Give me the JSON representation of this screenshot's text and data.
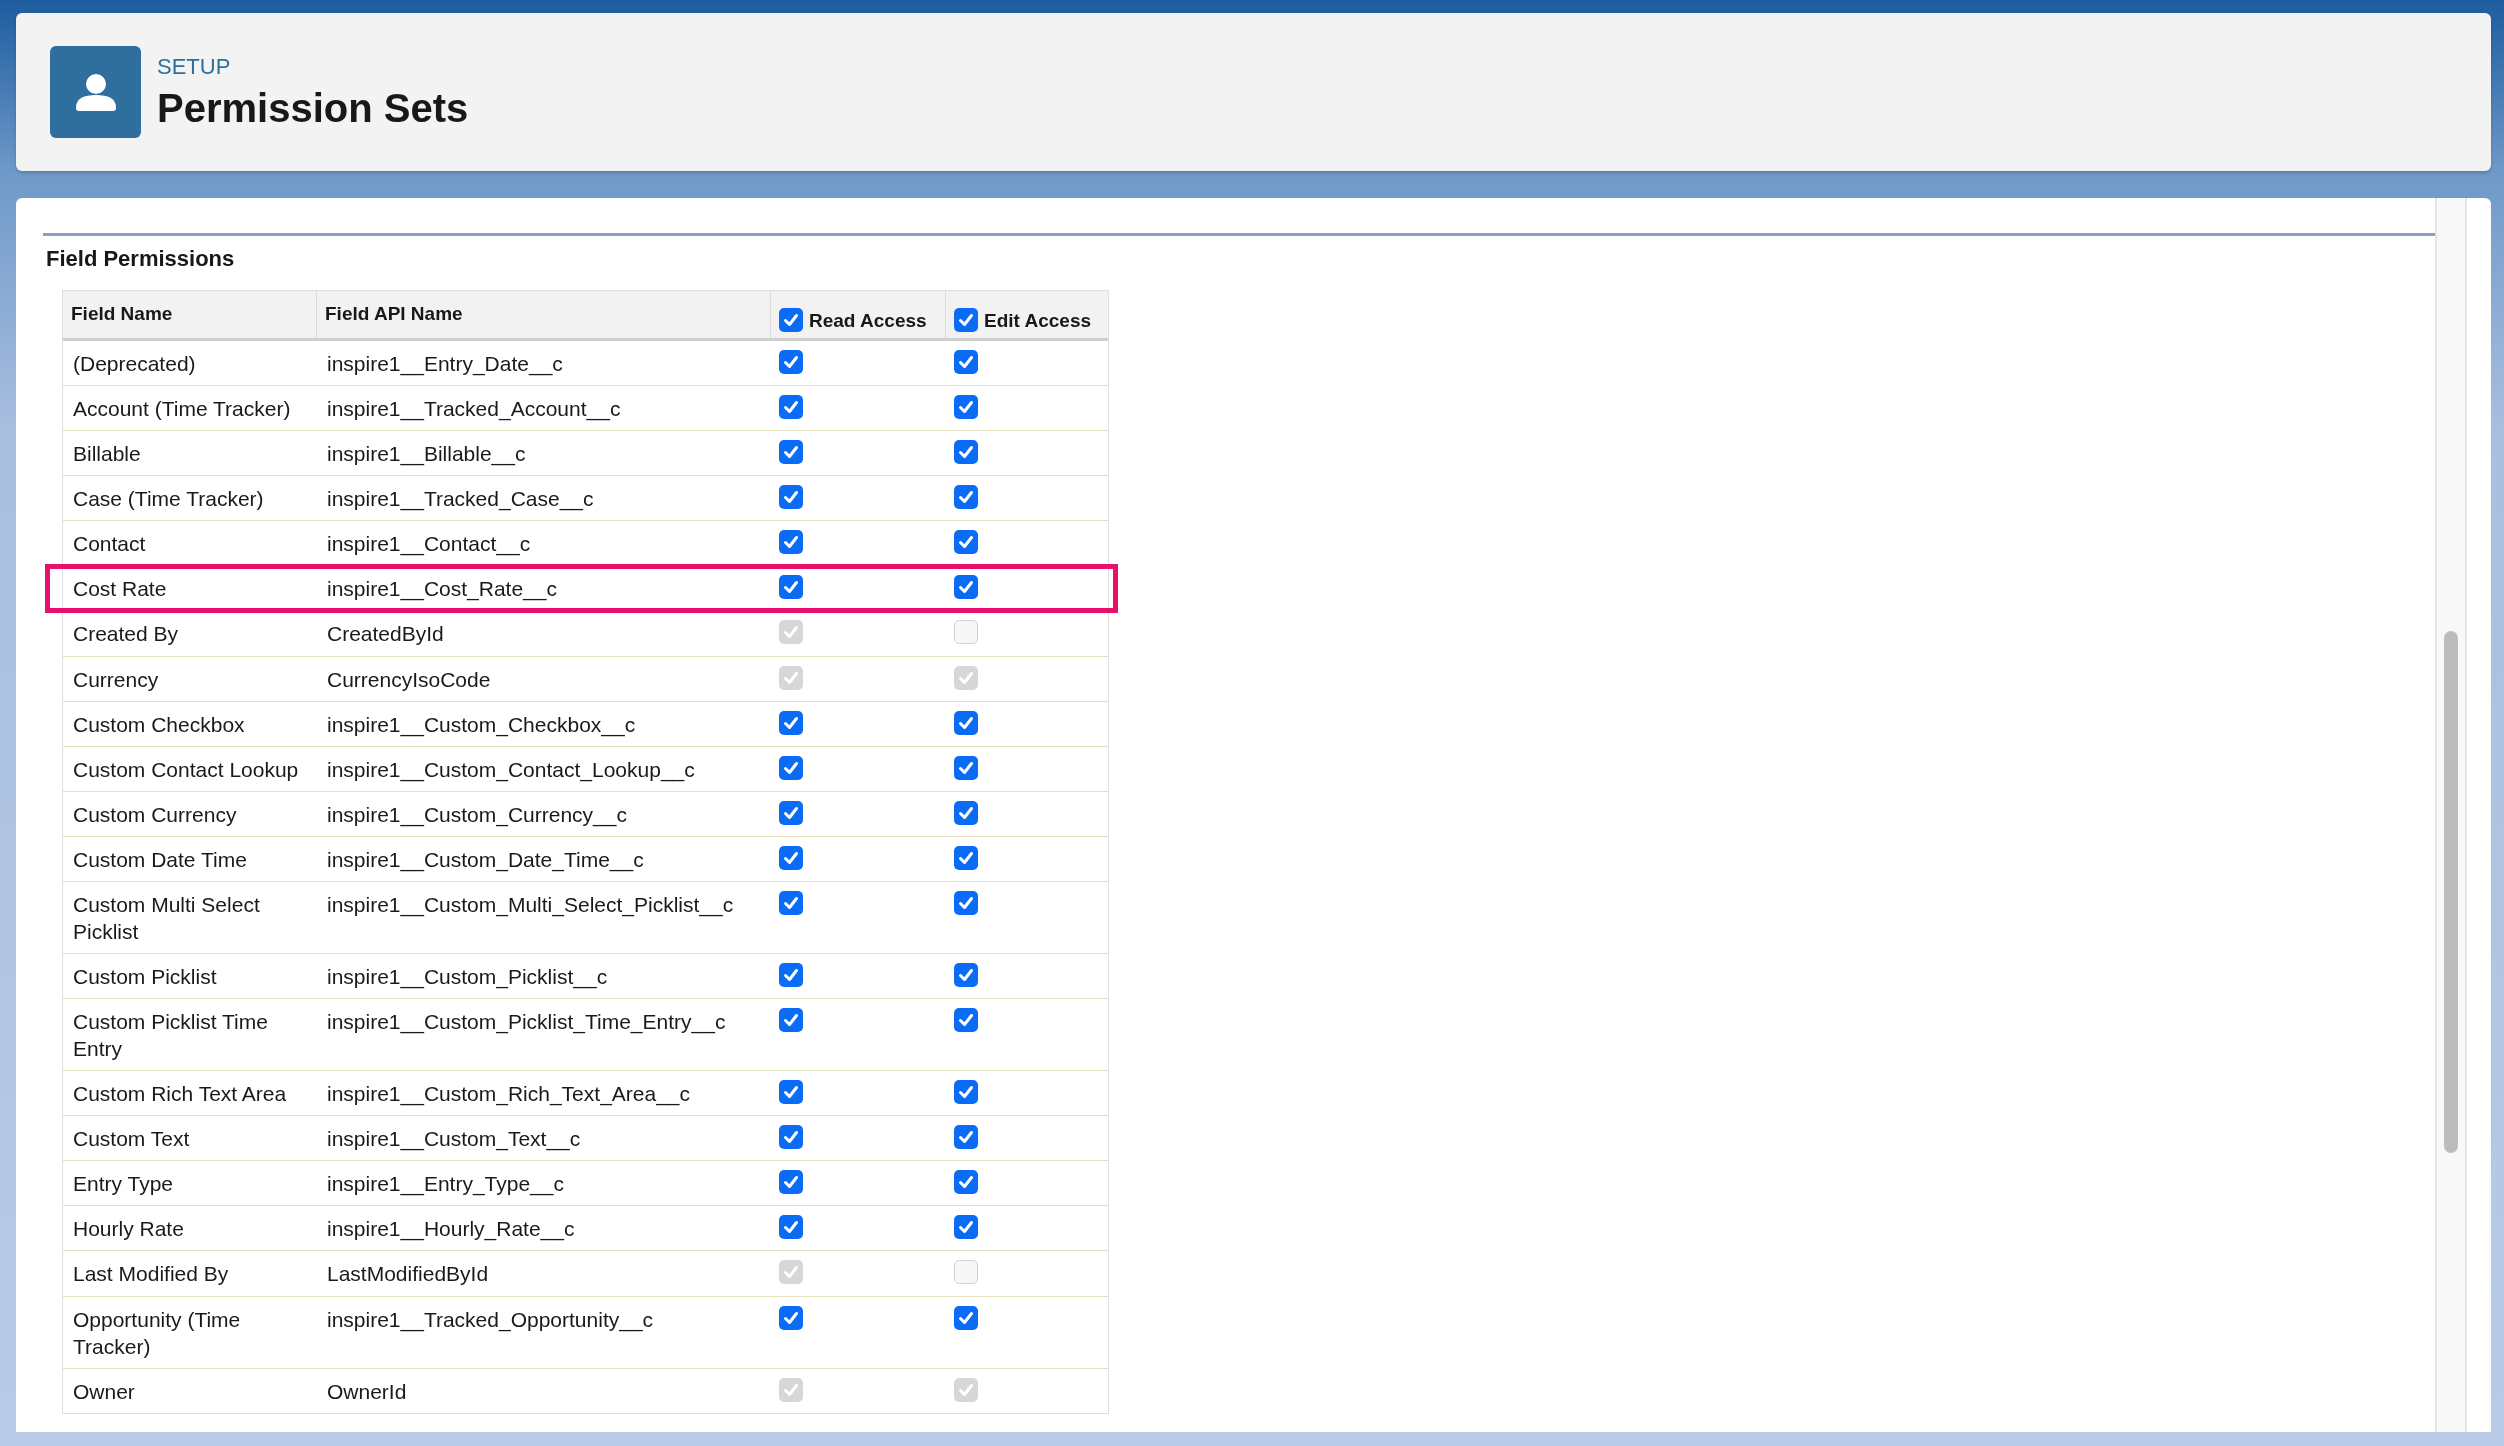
{
  "header": {
    "eyebrow": "SETUP",
    "title": "Permission Sets"
  },
  "section": {
    "title": "Field Permissions"
  },
  "table": {
    "columns": [
      {
        "label": "Field Name",
        "kind": "text"
      },
      {
        "label": "Field API Name",
        "kind": "text"
      },
      {
        "label": "Read Access",
        "kind": "checkbox",
        "checked": true
      },
      {
        "label": "Edit Access",
        "kind": "checkbox",
        "checked": true
      }
    ],
    "rows": [
      {
        "name": "(Deprecated)",
        "api_name": "inspire1__Entry_Date__c",
        "read": {
          "checked": true,
          "disabled": false
        },
        "edit": {
          "checked": true,
          "disabled": false
        },
        "highlighted": false
      },
      {
        "name": "Account (Time Tracker)",
        "api_name": "inspire1__Tracked_Account__c",
        "read": {
          "checked": true,
          "disabled": false
        },
        "edit": {
          "checked": true,
          "disabled": false
        },
        "highlighted": false
      },
      {
        "name": "Billable",
        "api_name": "inspire1__Billable__c",
        "read": {
          "checked": true,
          "disabled": false
        },
        "edit": {
          "checked": true,
          "disabled": false
        },
        "highlighted": false
      },
      {
        "name": "Case (Time Tracker)",
        "api_name": "inspire1__Tracked_Case__c",
        "read": {
          "checked": true,
          "disabled": false
        },
        "edit": {
          "checked": true,
          "disabled": false
        },
        "highlighted": false
      },
      {
        "name": "Contact",
        "api_name": "inspire1__Contact__c",
        "read": {
          "checked": true,
          "disabled": false
        },
        "edit": {
          "checked": true,
          "disabled": false
        },
        "highlighted": false
      },
      {
        "name": "Cost Rate",
        "api_name": "inspire1__Cost_Rate__c",
        "read": {
          "checked": true,
          "disabled": false
        },
        "edit": {
          "checked": true,
          "disabled": false
        },
        "highlighted": true
      },
      {
        "name": "Created By",
        "api_name": "CreatedById",
        "read": {
          "checked": true,
          "disabled": true
        },
        "edit": {
          "checked": false,
          "disabled": true
        },
        "highlighted": false
      },
      {
        "name": "Currency",
        "api_name": "CurrencyIsoCode",
        "read": {
          "checked": true,
          "disabled": true
        },
        "edit": {
          "checked": true,
          "disabled": true
        },
        "highlighted": false
      },
      {
        "name": "Custom Checkbox",
        "api_name": "inspire1__Custom_Checkbox__c",
        "read": {
          "checked": true,
          "disabled": false
        },
        "edit": {
          "checked": true,
          "disabled": false
        },
        "highlighted": false
      },
      {
        "name": "Custom Contact Lookup",
        "api_name": "inspire1__Custom_Contact_Lookup__c",
        "read": {
          "checked": true,
          "disabled": false
        },
        "edit": {
          "checked": true,
          "disabled": false
        },
        "highlighted": false
      },
      {
        "name": "Custom Currency",
        "api_name": "inspire1__Custom_Currency__c",
        "read": {
          "checked": true,
          "disabled": false
        },
        "edit": {
          "checked": true,
          "disabled": false
        },
        "highlighted": false
      },
      {
        "name": "Custom Date Time",
        "api_name": "inspire1__Custom_Date_Time__c",
        "read": {
          "checked": true,
          "disabled": false
        },
        "edit": {
          "checked": true,
          "disabled": false
        },
        "highlighted": false
      },
      {
        "name": "Custom Multi Select Picklist",
        "api_name": "inspire1__Custom_Multi_Select_Picklist__c",
        "read": {
          "checked": true,
          "disabled": false
        },
        "edit": {
          "checked": true,
          "disabled": false
        },
        "highlighted": false
      },
      {
        "name": "Custom Picklist",
        "api_name": "inspire1__Custom_Picklist__c",
        "read": {
          "checked": true,
          "disabled": false
        },
        "edit": {
          "checked": true,
          "disabled": false
        },
        "highlighted": false
      },
      {
        "name": "Custom Picklist Time Entry",
        "api_name": "inspire1__Custom_Picklist_Time_Entry__c",
        "read": {
          "checked": true,
          "disabled": false
        },
        "edit": {
          "checked": true,
          "disabled": false
        },
        "highlighted": false
      },
      {
        "name": "Custom Rich Text Area",
        "api_name": "inspire1__Custom_Rich_Text_Area__c",
        "read": {
          "checked": true,
          "disabled": false
        },
        "edit": {
          "checked": true,
          "disabled": false
        },
        "highlighted": false
      },
      {
        "name": "Custom Text",
        "api_name": "inspire1__Custom_Text__c",
        "read": {
          "checked": true,
          "disabled": false
        },
        "edit": {
          "checked": true,
          "disabled": false
        },
        "highlighted": false
      },
      {
        "name": "Entry Type",
        "api_name": "inspire1__Entry_Type__c",
        "read": {
          "checked": true,
          "disabled": false
        },
        "edit": {
          "checked": true,
          "disabled": false
        },
        "highlighted": false
      },
      {
        "name": "Hourly Rate",
        "api_name": "inspire1__Hourly_Rate__c",
        "read": {
          "checked": true,
          "disabled": false
        },
        "edit": {
          "checked": true,
          "disabled": false
        },
        "highlighted": false
      },
      {
        "name": "Last Modified By",
        "api_name": "LastModifiedById",
        "read": {
          "checked": true,
          "disabled": true
        },
        "edit": {
          "checked": false,
          "disabled": true
        },
        "highlighted": false
      },
      {
        "name": "Opportunity (Time Tracker)",
        "api_name": "inspire1__Tracked_Opportunity__c",
        "read": {
          "checked": true,
          "disabled": false
        },
        "edit": {
          "checked": true,
          "disabled": false
        },
        "highlighted": false
      },
      {
        "name": "Owner",
        "api_name": "OwnerId",
        "read": {
          "checked": true,
          "disabled": true
        },
        "edit": {
          "checked": true,
          "disabled": true
        },
        "highlighted": false
      }
    ]
  }
}
